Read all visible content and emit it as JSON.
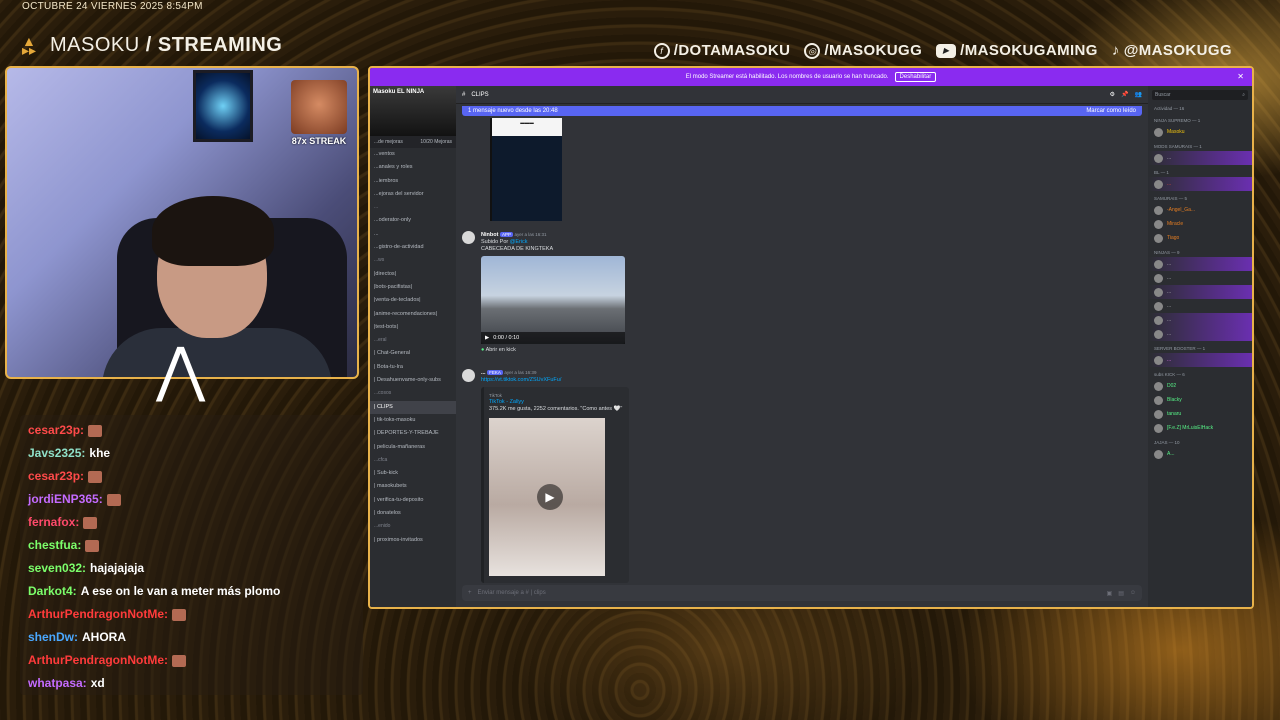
{
  "overlay": {
    "date": "OCTUBRE 24 VIERNES 2025 8:54PM",
    "brand_light": "MASOKU",
    "brand_bold": "/ STREAMING",
    "socials": [
      {
        "icon": "facebook-icon",
        "label": "/DOTAMASOKU"
      },
      {
        "icon": "instagram-icon",
        "label": "/MASOKUGG"
      },
      {
        "icon": "youtube-icon",
        "label": "/MASOKUGAMING"
      },
      {
        "icon": "tiktok-icon",
        "label": "@MASOKUGG"
      }
    ],
    "streak": "87x STREAK",
    "accent": "#e8b24a"
  },
  "chat": [
    {
      "user": "cesar23p:",
      "color": "#ff4a4a",
      "text": "",
      "emote": true
    },
    {
      "user": "Javs2325:",
      "color": "#8fe0c8",
      "text": "khe",
      "emote": false
    },
    {
      "user": "cesar23p:",
      "color": "#ff4a4a",
      "text": "",
      "emote": true
    },
    {
      "user": "jordiENP365:",
      "color": "#c46bff",
      "text": "",
      "emote": true
    },
    {
      "user": "fernafox:",
      "color": "#ff4a6b",
      "text": "",
      "emote": true
    },
    {
      "user": "chestfua:",
      "color": "#7cff6b",
      "text": "",
      "emote": true
    },
    {
      "user": "seven032:",
      "color": "#7cff6b",
      "text": "hajajajaja",
      "emote": false
    },
    {
      "user": "Darkot4:",
      "color": "#7cff6b",
      "text": "A ese on le van a meter más plomo",
      "emote": false
    },
    {
      "user": "ArthurPendragonNotMe:",
      "color": "#ff3b3b",
      "text": "",
      "emote": true
    },
    {
      "user": "shenDw:",
      "color": "#4aa8ff",
      "text": "AHORA",
      "emote": false
    },
    {
      "user": "ArthurPendragonNotMe:",
      "color": "#ff3b3b",
      "text": "",
      "emote": true
    },
    {
      "user": "whatpasa:",
      "color": "#c46bff",
      "text": "xd",
      "emote": false
    }
  ],
  "discord": {
    "banner": "El modo Streamer está habilitado. Los nombres de usuario se han truncado.",
    "banner_button": "Deshabilitar",
    "server_name": "Masoku EL NINJA",
    "boost_left": "...de mejoras",
    "boost_right": "10/20 Mejoras",
    "channels": [
      {
        "label": "...ventos",
        "type": "item"
      },
      {
        "label": "...anales y roles",
        "type": "item"
      },
      {
        "label": "...iembros",
        "type": "item"
      },
      {
        "label": "...ejoras del servidor",
        "type": "item"
      },
      {
        "label": "...",
        "type": "cat"
      },
      {
        "label": "...oderator-only",
        "type": "item"
      },
      {
        "label": "...",
        "type": "item"
      },
      {
        "label": "...gistro-de-actividad",
        "type": "item"
      },
      {
        "label": "...ws",
        "type": "cat"
      },
      {
        "label": "|directos|",
        "type": "item"
      },
      {
        "label": "|bots-pacifistas|",
        "type": "item"
      },
      {
        "label": "|venta-de-teclados|",
        "type": "item"
      },
      {
        "label": "|anime-recomendaciones|",
        "type": "item"
      },
      {
        "label": "|test-bots|",
        "type": "item"
      },
      {
        "label": "...eral",
        "type": "cat"
      },
      {
        "label": "| Chat-General",
        "type": "item"
      },
      {
        "label": "| Bota-tu-Ira",
        "type": "item"
      },
      {
        "label": "| Desahuenvame-only-subs",
        "type": "item"
      },
      {
        "label": "...cosos",
        "type": "cat"
      },
      {
        "label": "| CLIPS",
        "type": "active"
      },
      {
        "label": "| tik-toks-masoku",
        "type": "item"
      },
      {
        "label": "| DEPORTES-Y-TREBAJE",
        "type": "item"
      },
      {
        "label": "| pelicula-mañaneras",
        "type": "item"
      },
      {
        "label": "...cfca",
        "type": "cat"
      },
      {
        "label": "| Sub-kick",
        "type": "item"
      },
      {
        "label": "| masokubets",
        "type": "item"
      },
      {
        "label": "| verifica-tu-deposito",
        "type": "item"
      },
      {
        "label": "| donatelos",
        "type": "item"
      },
      {
        "label": "...enido",
        "type": "cat"
      },
      {
        "label": "| proximos-invitados",
        "type": "item"
      }
    ],
    "topbar_channel": "CLIPS",
    "new_messages": "1 mensaje nuevo desde las 20:48",
    "mark_read": "Marcar como leído",
    "post1": {
      "name": "Ninbot",
      "tag": "APP",
      "time": "ayer a las 16:31",
      "line1": "Subido Por",
      "mention": "@Erick",
      "line2": "CABECEADA DE KINGTEKA",
      "video_time": "0:00 / 0:10",
      "open_kick": "Abrir en kick"
    },
    "post2": {
      "name": "...",
      "tag": "FEKA",
      "time": "ayer a las 16:39",
      "link": "https://vt.tiktok.com/ZSUvXFuFu/",
      "source": "TikTok",
      "title": "TikTok - Zallyy",
      "desc": "375.2K me gusta, 2252 comentarios. \"Como antes 🤍\""
    },
    "compose_placeholder": "Enviar mensaje a #  |  clips",
    "search_placeholder": "Buscar",
    "members": [
      {
        "section": "Actividad — 16"
      },
      {
        "section": "NINJA SUPREMO — 1"
      },
      {
        "name": "Masoku",
        "color": "#f1c40f",
        "highlight": false
      },
      {
        "section": "MODS SAMURAIS — 1"
      },
      {
        "name": "...",
        "color": "#b9bbbe",
        "highlight": true
      },
      {
        "section": "BL — 1"
      },
      {
        "name": "...",
        "color": "#e74c3c",
        "highlight": true
      },
      {
        "section": "SAMURAIS — 5"
      },
      {
        "name": "-Angel_Ga...",
        "color": "#e67e22",
        "highlight": false
      },
      {
        "name": "Miracle",
        "color": "#e67e22",
        "highlight": false
      },
      {
        "name": "Tiago",
        "color": "#e67e22",
        "highlight": false
      },
      {
        "section": "NINJAS — 9"
      },
      {
        "name": "...",
        "color": "#b9bbbe",
        "highlight": true
      },
      {
        "name": "...",
        "color": "#b9bbbe",
        "highlight": false
      },
      {
        "name": "...",
        "color": "#b9bbbe",
        "highlight": true
      },
      {
        "name": "...",
        "color": "#b9bbbe",
        "highlight": false
      },
      {
        "name": "...",
        "color": "#b9bbbe",
        "highlight": true
      },
      {
        "name": "...",
        "color": "#b9bbbe",
        "highlight": true
      },
      {
        "section": "SERVER BOOSTER — 1"
      },
      {
        "name": "...",
        "color": "#f47fff",
        "highlight": true
      },
      {
        "section": "subs KICK — 6"
      },
      {
        "name": "D02",
        "color": "#57f287",
        "highlight": false
      },
      {
        "name": "Blacky",
        "color": "#57f287",
        "highlight": false
      },
      {
        "name": "tanaru",
        "color": "#57f287",
        "highlight": false
      },
      {
        "name": "[F.e.Z] MrLuisElHack",
        "color": "#57f287",
        "highlight": false
      },
      {
        "section": "JAJAS — 10"
      },
      {
        "name": "A...",
        "color": "#57f287",
        "highlight": false
      }
    ]
  }
}
